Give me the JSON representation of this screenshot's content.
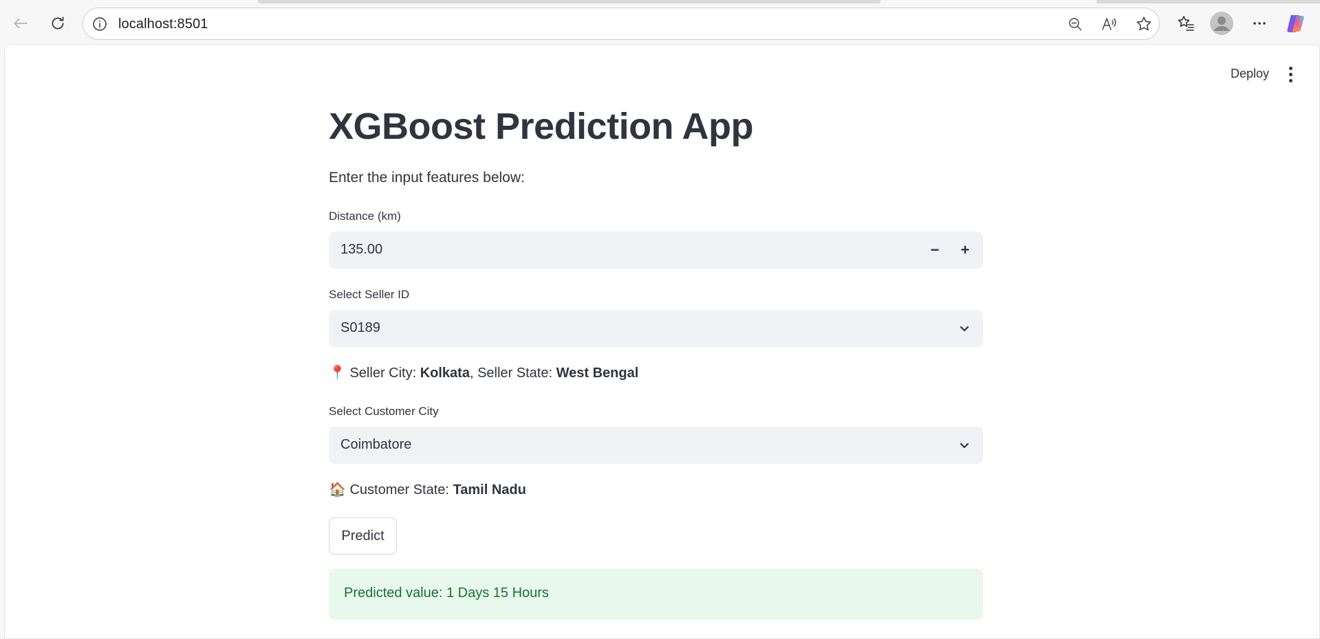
{
  "browser": {
    "url": "localhost:8501"
  },
  "header": {
    "deploy_label": "Deploy"
  },
  "app": {
    "title": "XGBoost Prediction App",
    "subtitle": "Enter the input features below:",
    "distance": {
      "label": "Distance (km)",
      "value": "135.00",
      "decrement": "−",
      "increment": "+"
    },
    "seller": {
      "label": "Select Seller ID",
      "value": "S0189"
    },
    "seller_info": {
      "icon": "📍",
      "city_prefix": "Seller City: ",
      "city": "Kolkata",
      "state_prefix": ", Seller State: ",
      "state": "West Bengal"
    },
    "customer": {
      "label": "Select Customer City",
      "value": "Coimbatore"
    },
    "customer_info": {
      "icon": "🏠",
      "state_prefix": "Customer State: ",
      "state": "Tamil Nadu"
    },
    "predict_label": "Predict",
    "result": "Predicted value: 1 Days 15 Hours"
  },
  "colors": {
    "text": "#31333f",
    "input_bg": "#f0f2f6",
    "success_bg": "#e8f8ec",
    "success_text": "#177233"
  }
}
